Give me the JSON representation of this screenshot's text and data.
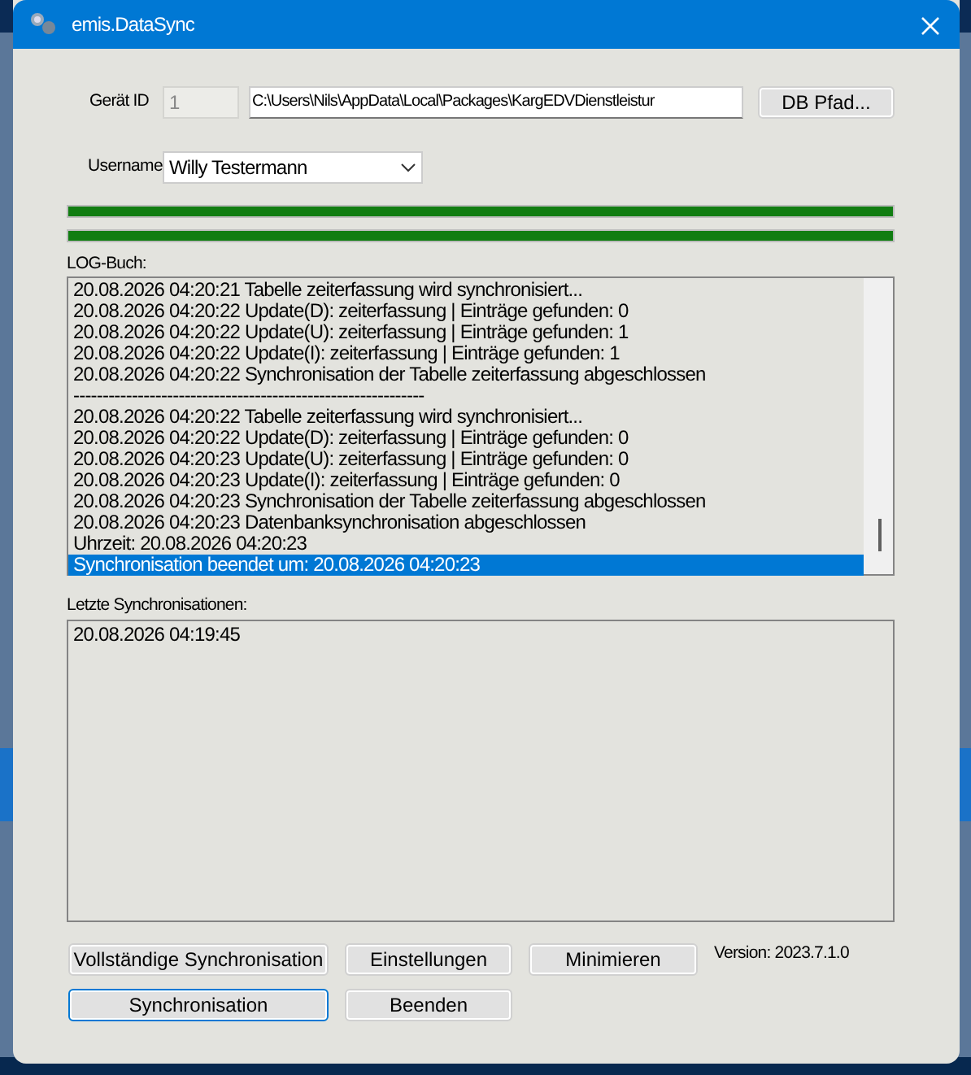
{
  "window": {
    "title": "emis.DataSync"
  },
  "device": {
    "label": "Gerät ID",
    "id_value": "1",
    "path_value": "C:\\Users\\Nils\\AppData\\Local\\Packages\\KargEDVDienstleistur",
    "path_button": "DB Pfad..."
  },
  "user": {
    "label": "Username",
    "value": "Willy Testermann"
  },
  "progress_bars": [
    {
      "level": 1
    },
    {
      "level": 1
    }
  ],
  "log": {
    "label": "LOG-Buch:",
    "lines": [
      {
        "text": "20.08.2026 04:20:21 Tabelle zeiterfassung wird synchronisiert...",
        "selected": false
      },
      {
        "text": "20.08.2026 04:20:22 Update(D): zeiterfassung | Einträge gefunden: 0",
        "selected": false
      },
      {
        "text": "20.08.2026 04:20:22 Update(U): zeiterfassung | Einträge gefunden: 1",
        "selected": false
      },
      {
        "text": "20.08.2026 04:20:22 Update(I): zeiterfassung | Einträge gefunden: 1",
        "selected": false
      },
      {
        "text": "20.08.2026 04:20:22 Synchronisation der Tabelle zeiterfassung abgeschlossen",
        "selected": false
      },
      {
        "text": "------------------------------------------------------------",
        "selected": false
      },
      {
        "text": "20.08.2026 04:20:22 Tabelle zeiterfassung wird synchronisiert...",
        "selected": false
      },
      {
        "text": "20.08.2026 04:20:22 Update(D): zeiterfassung | Einträge gefunden: 0",
        "selected": false
      },
      {
        "text": "20.08.2026 04:20:23 Update(U): zeiterfassung | Einträge gefunden: 0",
        "selected": false
      },
      {
        "text": "20.08.2026 04:20:23 Update(I): zeiterfassung | Einträge gefunden: 0",
        "selected": false
      },
      {
        "text": "20.08.2026 04:20:23 Synchronisation der Tabelle zeiterfassung abgeschlossen",
        "selected": false
      },
      {
        "text": "20.08.2026 04:20:23 Datenbanksynchronisation abgeschlossen",
        "selected": false
      },
      {
        "text": "Uhrzeit: 20.08.2026 04:20:23",
        "selected": false
      },
      {
        "text": "Synchronisation beendet um: 20.08.2026 04:20:23",
        "selected": true
      }
    ]
  },
  "recent": {
    "label": "Letzte Synchronisationen:",
    "items": [
      "20.08.2026 04:19:45"
    ]
  },
  "buttons": [
    {
      "label": "Vollständige Synchronisation",
      "focused": false
    },
    {
      "label": "Einstellungen",
      "focused": false
    },
    {
      "label": "Minimieren",
      "focused": false
    },
    {
      "label": "Synchronisation",
      "focused": true
    },
    {
      "label": "Beenden",
      "focused": false
    }
  ],
  "version": "Version: 2023.7.1.0"
}
